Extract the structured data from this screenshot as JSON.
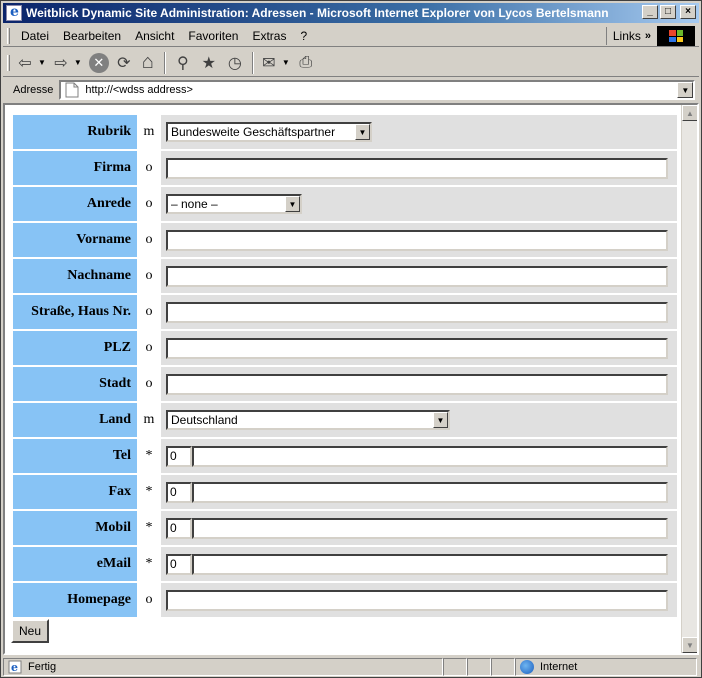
{
  "window": {
    "title": "Weitblick Dynamic Site Administration: Adressen - Microsoft Internet Explorer von Lycos Bertelsmann",
    "minimize": "_",
    "maximize": "□",
    "close": "×"
  },
  "menu": {
    "items": [
      "Datei",
      "Bearbeiten",
      "Ansicht",
      "Favoriten",
      "Extras",
      "?"
    ],
    "links_label": "Links",
    "links_chevron": "»"
  },
  "toolbar": {
    "icons": [
      "back-icon",
      "forward-icon",
      "stop-icon",
      "refresh-icon",
      "home-icon",
      "search-icon",
      "favorites-icon",
      "history-icon",
      "mail-icon",
      "print-icon"
    ],
    "back": "⇦",
    "forward": "⇨",
    "stop": "✕",
    "refresh": "⟳",
    "home": "⌂",
    "search": "⚲",
    "favorites": "★",
    "history": "◷",
    "mail": "✉",
    "print": "⎙",
    "dropdown": "▼"
  },
  "address": {
    "label": "Adresse",
    "url": "http://<wdss address>"
  },
  "form": {
    "rows": [
      {
        "label": "Rubrik",
        "flag": "m",
        "type": "select",
        "value": "Bundesweite Geschäftspartner"
      },
      {
        "label": "Firma",
        "flag": "o",
        "type": "text",
        "value": ""
      },
      {
        "label": "Anrede",
        "flag": "o",
        "type": "select",
        "value": "– none –"
      },
      {
        "label": "Vorname",
        "flag": "o",
        "type": "text",
        "value": ""
      },
      {
        "label": "Nachname",
        "flag": "o",
        "type": "text",
        "value": ""
      },
      {
        "label": "Straße, Haus Nr.",
        "flag": "o",
        "type": "text",
        "value": ""
      },
      {
        "label": "PLZ",
        "flag": "o",
        "type": "text",
        "value": ""
      },
      {
        "label": "Stadt",
        "flag": "o",
        "type": "text",
        "value": ""
      },
      {
        "label": "Land",
        "flag": "m",
        "type": "select",
        "value": "Deutschland"
      },
      {
        "label": "Tel",
        "flag": "*",
        "type": "phone",
        "prefix": "0",
        "value": ""
      },
      {
        "label": "Fax",
        "flag": "*",
        "type": "phone",
        "prefix": "0",
        "value": ""
      },
      {
        "label": "Mobil",
        "flag": "*",
        "type": "phone",
        "prefix": "0",
        "value": ""
      },
      {
        "label": "eMail",
        "flag": "*",
        "type": "phone",
        "prefix": "0",
        "value": ""
      },
      {
        "label": "Homepage",
        "flag": "o",
        "type": "text",
        "value": ""
      }
    ],
    "new_button": "Neu"
  },
  "status": {
    "text": "Fertig",
    "zone": "Internet"
  },
  "colors": {
    "label_bg": "#87c3f5",
    "field_bg": "#e0e0e0",
    "title_start": "#0a246a"
  }
}
